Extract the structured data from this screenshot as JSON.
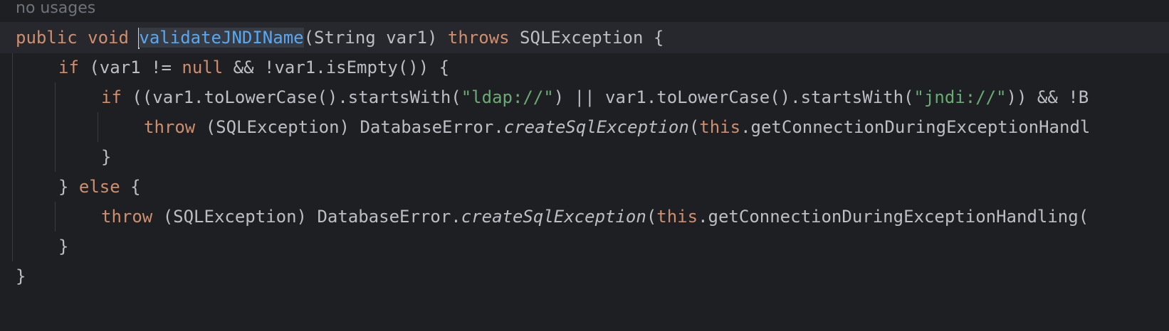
{
  "editor": {
    "usage_hint": "no usages",
    "lines": [
      {
        "t1": "public",
        "t2": "void",
        "t3": "validateJNDIName",
        "t4": "(String var1) ",
        "t5": "throws",
        "t6": " SQLException {"
      },
      {
        "t1": "if",
        "t2": " (var1 != ",
        "t3": "null",
        "t4": " && !var1.isEmpty()) {"
      },
      {
        "t1": "if",
        "t2": " ((var1.toLowerCase().startsWith(",
        "t3": "\"ldap://\"",
        "t4": ") || var1.toLowerCase().startsWith(",
        "t5": "\"jndi://\"",
        "t6": ")) && !B"
      },
      {
        "t1": "throw",
        "t2": " (SQLException) DatabaseError.",
        "t3": "createSqlException",
        "t4": "(",
        "t5": "this",
        "t6": ".getConnectionDuringExceptionHandl"
      },
      {
        "t1": "}"
      },
      {
        "t1": "} ",
        "t2": "else",
        "t3": " {"
      },
      {
        "t1": "throw",
        "t2": " (SQLException) DatabaseError.",
        "t3": "createSqlException",
        "t4": "(",
        "t5": "this",
        "t6": ".getConnectionDuringExceptionHandling("
      },
      {
        "t1": "}"
      },
      {
        "t1": "}"
      }
    ]
  },
  "colors": {
    "background": "#1e1f22",
    "current_line": "#26282e",
    "text": "#bcbec4",
    "keyword": "#cf8e6d",
    "string": "#6aab73",
    "method_declaration": "#56a8f5",
    "hint": "#6f737a"
  }
}
